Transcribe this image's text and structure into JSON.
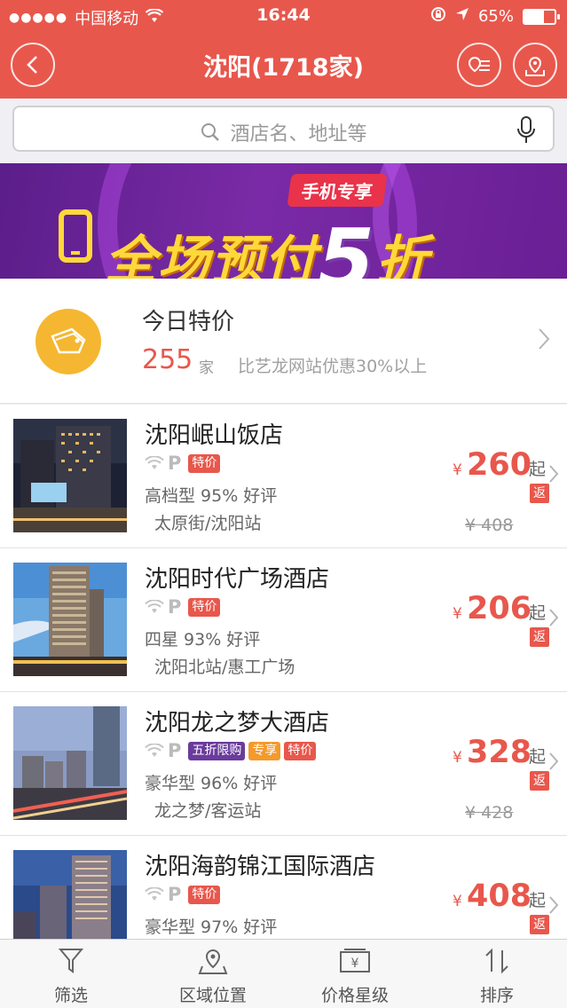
{
  "status_bar": {
    "carrier": "中国移动",
    "time": "16:44",
    "battery": "65%",
    "battery_level": 0.65
  },
  "nav": {
    "title": "沈阳(1718家)"
  },
  "search": {
    "placeholder": "酒店名、地址等"
  },
  "banner": {
    "tag": "手机专享",
    "text_main": "全场预付",
    "text_number": "5",
    "text_tail": "折"
  },
  "special_offer": {
    "title": "今日特价",
    "count": "255",
    "unit": "家",
    "desc": "比艺龙网站优惠30%以上"
  },
  "hotels": [
    {
      "name": "沈阳岷山饭店",
      "badges": [
        "特价"
      ],
      "rating": "高档型  95%  好评",
      "area": "太原街/沈阳站",
      "currency": "¥",
      "price": "260",
      "price_suffix": "起",
      "rebate": "返",
      "orig_price": "¥  408"
    },
    {
      "name": "沈阳时代广场酒店",
      "badges": [
        "特价"
      ],
      "rating": "四星  93%  好评",
      "area": "沈阳北站/惠工广场",
      "currency": "¥",
      "price": "206",
      "price_suffix": "起",
      "rebate": "返",
      "orig_price": ""
    },
    {
      "name": "沈阳龙之梦大酒店",
      "badges": [
        "五折限购",
        "专享",
        "特价"
      ],
      "rating": "豪华型  96%  好评",
      "area": "龙之梦/客运站",
      "currency": "¥",
      "price": "328",
      "price_suffix": "起",
      "rebate": "返",
      "orig_price": "¥  428"
    },
    {
      "name": "沈阳海韵锦江国际酒店",
      "badges": [
        "特价"
      ],
      "rating": "豪华型  97%  好评",
      "area": "",
      "currency": "¥",
      "price": "408",
      "price_suffix": "起",
      "rebate": "返",
      "orig_price": ""
    }
  ],
  "tabbar": {
    "filter": "筛选",
    "location": "区域位置",
    "price_star": "价格星级",
    "sort": "排序"
  },
  "colors": {
    "primary": "#e8574c",
    "special_icon": "#f5b731",
    "badge_purple": "#6a3b9c",
    "badge_orange": "#f39a2c"
  }
}
